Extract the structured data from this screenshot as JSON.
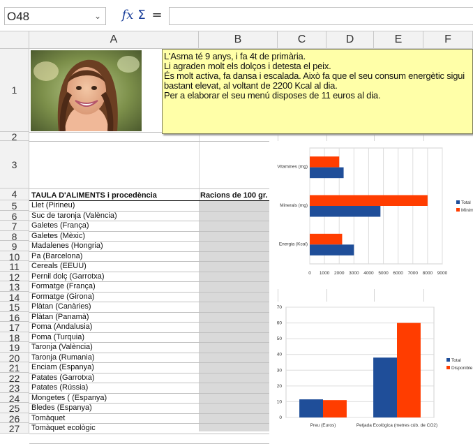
{
  "formula_bar": {
    "cell_ref": "O48",
    "function_wizard_icon": "function-wizard-icon",
    "sum_icon": "sum-icon",
    "formula_icon": "equals-icon",
    "value": ""
  },
  "columns": [
    "A",
    "B",
    "C",
    "D",
    "E",
    "F"
  ],
  "rows": [
    "1",
    "2",
    "3",
    "4",
    "5",
    "6",
    "7",
    "8",
    "9",
    "10",
    "11",
    "12",
    "13",
    "14",
    "15",
    "16",
    "17",
    "18",
    "19",
    "20",
    "21",
    "22",
    "23",
    "24",
    "25",
    "26",
    "27"
  ],
  "note_lines": [
    "L'Asma té 9 anys, i fa 4t de primària.",
    "Li agraden molt els dolços i detesta el peix.",
    "És molt activa, fa dansa i escalada. Això fa que el seu consum energètic sigui",
    "bastant elevat, al voltant de 2200 Kcal al dia.",
    "Per a elaborar el seu menú disposes de 11 euros al dia."
  ],
  "table": {
    "header_a": "TAULA D'ALIMENTS i procedència",
    "header_b": "Racions de 100 gr.",
    "items": [
      "Llet (Pirineu)",
      "Suc de taronja (València)",
      "Galetes (França)",
      "Galetes (Mèxic)",
      "Madalenes (Hongria)",
      "Pa (Barcelona)",
      "Cereals (EEUU)",
      "Pernil dolç (Garrotxa)",
      "Formatge (França)",
      "Formatge (Girona)",
      "Plàtan (Canàries)",
      "Plàtan (Panamà)",
      "Poma (Andalusia)",
      "Poma (Turquia)",
      "Taronja (València)",
      "Taronja (Rumania)",
      "Enciam (Espanya)",
      "Patates (Garrotxa)",
      "Patates (Rússia)",
      "Mongetes ( (Espanya)",
      "Bledes  (Espanya)",
      "Tomàquet",
      "Tomàquet ecològic"
    ]
  },
  "colors": {
    "total": "#1f4e99",
    "minim": "#ff3d00",
    "note_bg": "#ffffa8"
  },
  "chart_data": [
    {
      "type": "bar",
      "orientation": "horizontal",
      "categories": [
        "Energia (Kcal)",
        "Minerals (mg)",
        "Vitamines (mg)"
      ],
      "series": [
        {
          "name": "Total",
          "values": [
            3000,
            4800,
            2300
          ]
        },
        {
          "name": "Mínim",
          "values": [
            2200,
            8000,
            2000
          ]
        }
      ],
      "xlim": [
        0,
        9000
      ],
      "xticks": [
        "0",
        "1000",
        "2000",
        "3000",
        "4000",
        "5000",
        "6000",
        "7000",
        "8000",
        "9000"
      ],
      "legend": "right",
      "legend_labels": [
        "Total",
        "Mínim"
      ]
    },
    {
      "type": "bar",
      "categories": [
        "Preu (Euros)",
        "Petjada Ecològica (metres cúb. de CO2)"
      ],
      "series": [
        {
          "name": "Total",
          "values": [
            11.5,
            38
          ]
        },
        {
          "name": "Disponible",
          "values": [
            11,
            60
          ]
        }
      ],
      "ylim": [
        0,
        70
      ],
      "yticks": [
        "0",
        "10",
        "20",
        "30",
        "40",
        "50",
        "60",
        "70"
      ],
      "legend": "right",
      "legend_labels": [
        "Total",
        "Disponible"
      ]
    }
  ]
}
